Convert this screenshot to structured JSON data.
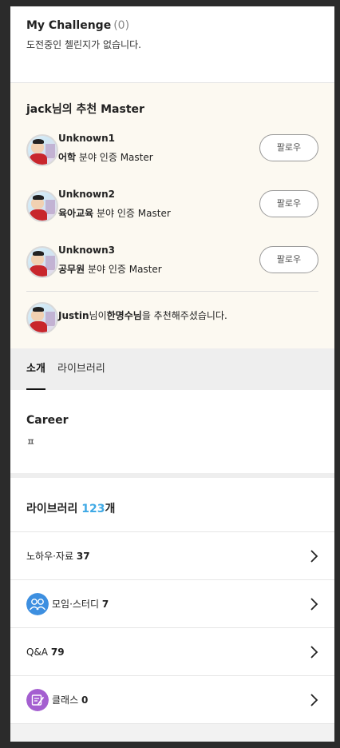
{
  "challenge": {
    "title": "My Challenge",
    "count": "(0)",
    "empty_message": "도전중인 첼린지가 없습니다."
  },
  "recommend": {
    "title": "jack님의 추천 Master",
    "follow_label": "팔로우",
    "masters": [
      {
        "name": "Unknown1",
        "field": "어학",
        "suffix": " 분야 인증 Master"
      },
      {
        "name": "Unknown2",
        "field": "육아교육",
        "suffix": " 분야 인증 Master"
      },
      {
        "name": "Unknown3",
        "field": "공무원",
        "suffix": " 분야 인증 Master"
      }
    ],
    "recommended_by": {
      "name": "Justin",
      "mid": "님이",
      "target": "한명수님",
      "tail": "을 추천해주셨습니다."
    }
  },
  "tabs": [
    {
      "label": "소개",
      "active": true
    },
    {
      "label": "라이브러리",
      "active": false
    }
  ],
  "career": {
    "title": "Career",
    "text": "ㅍ"
  },
  "library": {
    "title": "라이브러리",
    "count": "123",
    "unit": "개",
    "items": [
      {
        "label": "노하우·자료",
        "count": "37",
        "icon": ""
      },
      {
        "label": "모임·스터디",
        "count": "7",
        "icon": "group-icon",
        "icon_color": "#3d8fe0"
      },
      {
        "label": "Q&A",
        "count": "79",
        "icon": ""
      },
      {
        "label": "클래스",
        "count": "0",
        "icon": "class-icon",
        "icon_color": "#a45fd0"
      }
    ]
  }
}
